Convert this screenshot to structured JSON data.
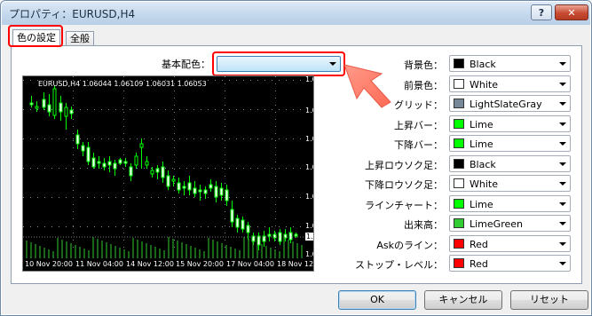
{
  "window": {
    "title": "プロパティ：EURUSD,H4",
    "help": "?",
    "close": "✕"
  },
  "tabs": [
    "色の設定",
    "全般"
  ],
  "basic_color": {
    "label": "基本配色：",
    "value": ""
  },
  "chart": {
    "header": "EURUSD,H4  1.06044 1.06109 1.06031 1.06053",
    "y_ticks": [
      "1.09440",
      "1.08770",
      "1.08140",
      "1.07510",
      "1.06895",
      "1.06265",
      "1.06053",
      "1.05635"
    ],
    "x_ticks": [
      "10 Nov 20:00",
      "11 Nov 04:00",
      "14 Nov 12:00",
      "15 Nov 20:00",
      "17 Nov 04:00",
      "18 Nov 12:00",
      "20 Nov 08:00"
    ],
    "colors": {
      "background": "#000000",
      "foreground": "#ffffff",
      "grid": "#778899",
      "bull": "#00ff00",
      "bear": "#00ff00",
      "bull_candle": "#000000",
      "bear_candle": "#ffffff",
      "line": "#00ff00",
      "volume": "#32cd32",
      "ask": "#ff0000",
      "stop": "#ff0000"
    }
  },
  "settings": [
    {
      "label": "背景色：",
      "value": "Black",
      "color": "#000000"
    },
    {
      "label": "前景色：",
      "value": "White",
      "color": "#ffffff"
    },
    {
      "label": "グリッド：",
      "value": "LightSlateGray",
      "color": "#778899"
    },
    {
      "label": "上昇バー：",
      "value": "Lime",
      "color": "#00ff00"
    },
    {
      "label": "下降バー：",
      "value": "Lime",
      "color": "#00ff00"
    },
    {
      "label": "上昇ロウソク足：",
      "value": "Black",
      "color": "#000000"
    },
    {
      "label": "下降ロウソク足：",
      "value": "White",
      "color": "#ffffff"
    },
    {
      "label": "ラインチャート：",
      "value": "Lime",
      "color": "#00ff00"
    },
    {
      "label": "出来高：",
      "value": "LimeGreen",
      "color": "#32cd32"
    },
    {
      "label": "Askのライン：",
      "value": "Red",
      "color": "#ff0000"
    },
    {
      "label": "ストップ・レベル：",
      "value": "Red",
      "color": "#ff0000"
    }
  ],
  "buttons": {
    "ok": "OK",
    "cancel": "キャンセル",
    "reset": "リセット"
  }
}
